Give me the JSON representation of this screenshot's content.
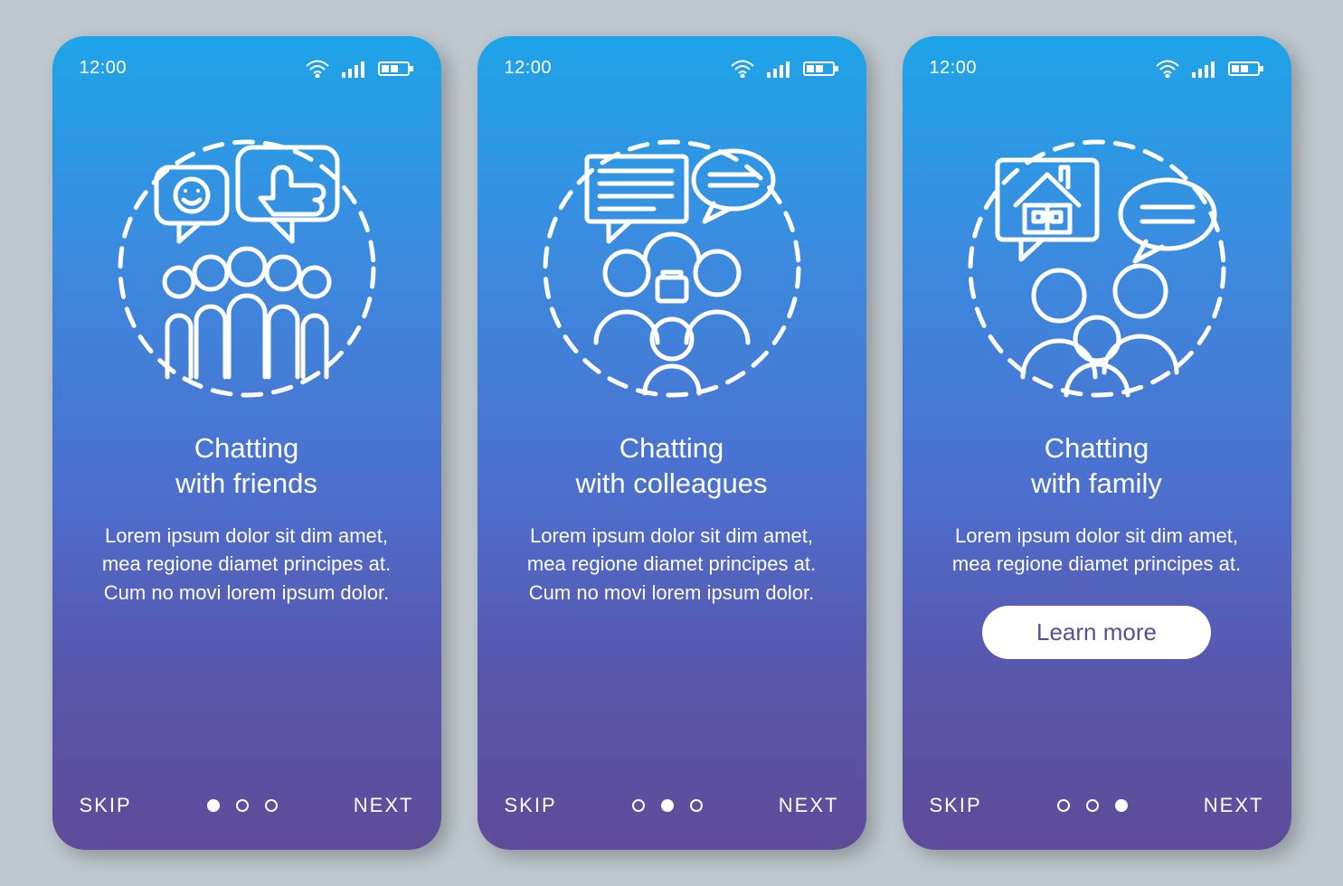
{
  "status": {
    "time": "12:00",
    "wifi": "wifi-icon",
    "signal": "signal-icon",
    "battery": "battery-icon"
  },
  "screens": [
    {
      "title": "Chatting\nwith friends",
      "body": "Lorem ipsum dolor sit dim amet, mea regione diamet principes at. Cum no movi lorem ipsum dolor.",
      "skip": "SKIP",
      "next": "NEXT",
      "activeDot": 0,
      "icon": "friends-group-icon"
    },
    {
      "title": "Chatting\nwith colleagues",
      "body": "Lorem ipsum dolor sit dim amet, mea regione diamet principes at. Cum no movi lorem ipsum dolor.",
      "skip": "SKIP",
      "next": "NEXT",
      "activeDot": 1,
      "icon": "colleagues-icon"
    },
    {
      "title": "Chatting\nwith family",
      "body": "Lorem ipsum dolor sit dim amet, mea regione diamet principes at.",
      "skip": "SKIP",
      "next": "NEXT",
      "activeDot": 2,
      "cta": "Learn more",
      "icon": "family-home-icon"
    }
  ],
  "colors": {
    "button_text": "#5e4c99"
  }
}
